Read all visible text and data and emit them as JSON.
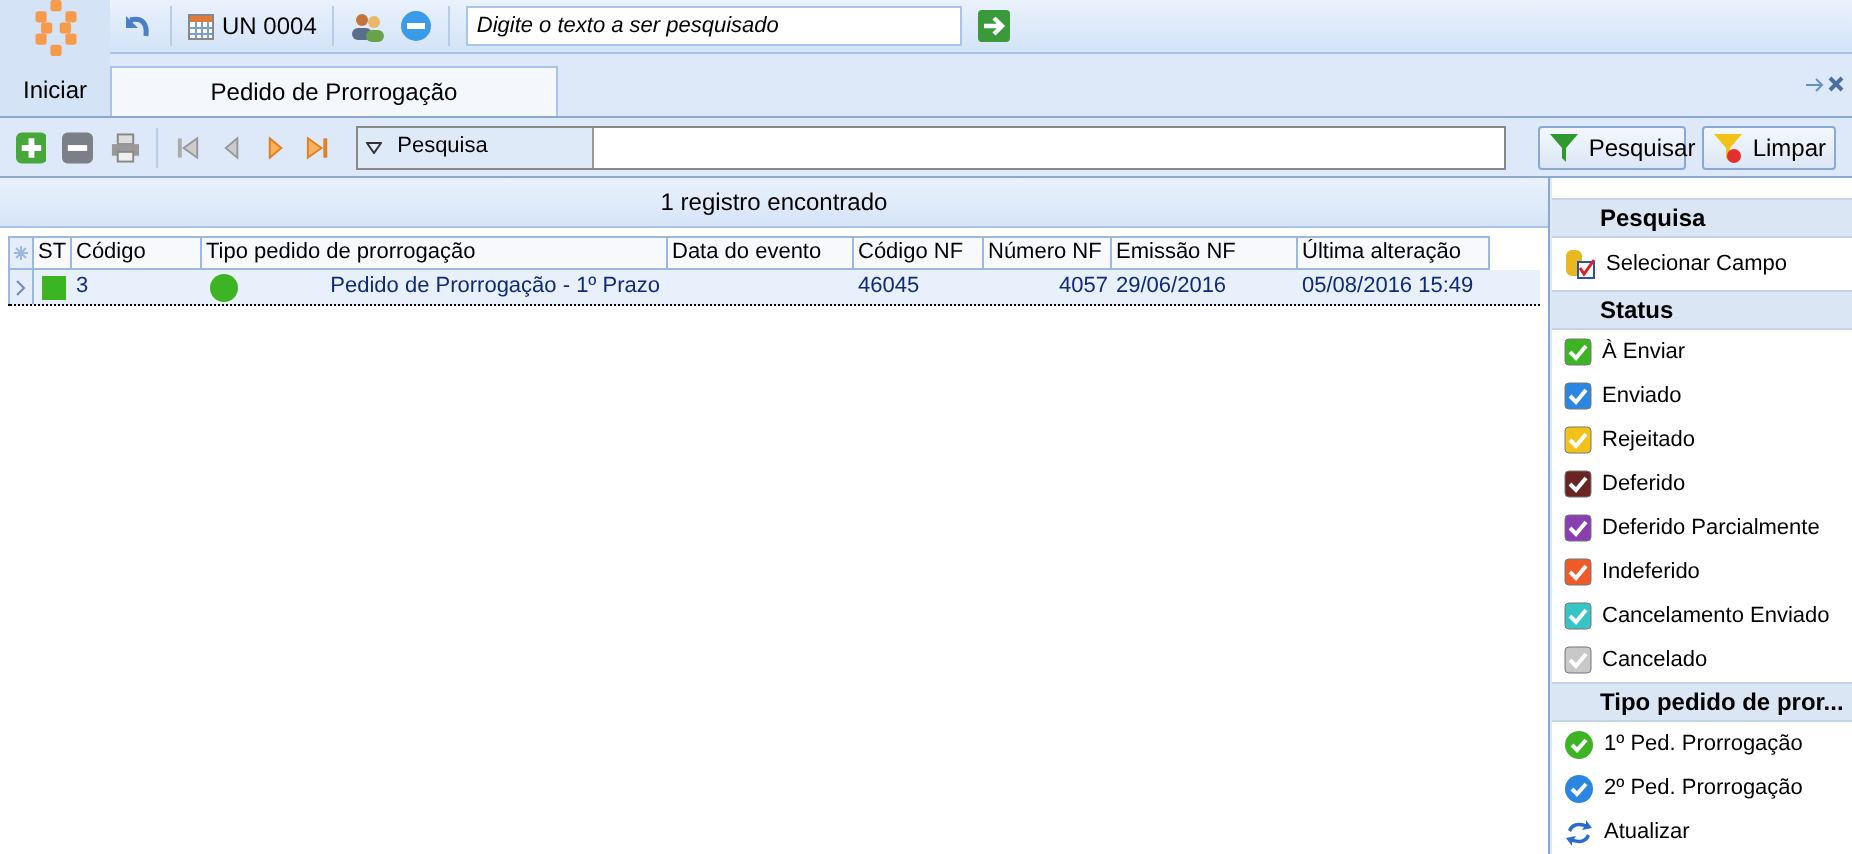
{
  "start_button": "Iniciar",
  "top_toolbar": {
    "unit": "UN 0004",
    "search": {
      "placeholder": "Digite o texto a ser pesquisado"
    }
  },
  "tab": {
    "label": "Pedido de Prorrogação"
  },
  "search_bar": {
    "dropdown": "Pesquisa",
    "buttons": [
      "Pesquisar",
      "Limpar"
    ]
  },
  "grid": {
    "summary": "1 registro encontrado",
    "columns": [
      "ST",
      "Código",
      "Tipo pedido de prorrogação",
      "Data do evento",
      "Código NF",
      "Número NF",
      "Emissão NF",
      "Última alteração"
    ],
    "rows": [
      {
        "selected": true,
        "status": {
          "color": "#3cb424"
        },
        "type_icon": {
          "color": "#3cb424"
        },
        "cells": [
          "",
          "3",
          "Pedido de Prorrogação - 1º Prazo",
          "",
          "46045",
          "4057",
          "29/06/2016",
          "05/08/2016 15:49"
        ]
      }
    ]
  },
  "side_panel": [
    {
      "title": "Pesquisa",
      "items": [
        {
          "kind": "field",
          "label": "Selecionar Campo"
        }
      ]
    },
    {
      "title": "Status",
      "items": [
        {
          "kind": "check",
          "label": "À Enviar",
          "color": "#3cb424"
        },
        {
          "kind": "check",
          "label": "Enviado",
          "color": "#2a86e0"
        },
        {
          "kind": "check",
          "label": "Rejeitado",
          "color": "#f2c21a"
        },
        {
          "kind": "check",
          "label": "Deferido",
          "color": "#6b2424"
        },
        {
          "kind": "check",
          "label": "Deferido Parcialmente",
          "color": "#8a3fb0"
        },
        {
          "kind": "check",
          "label": "Indeferido",
          "color": "#ee5a2a"
        },
        {
          "kind": "check",
          "label": "Cancelamento Enviado",
          "color": "#36c4c4"
        },
        {
          "kind": "check",
          "label": "Cancelado",
          "color": "#c8c8c8"
        }
      ]
    },
    {
      "title": "Tipo pedido de pror...",
      "items": [
        {
          "kind": "circle",
          "label": "1º Ped. Prorrogação",
          "color": "#3cb424"
        },
        {
          "kind": "circle",
          "label": "2º Ped. Prorrogação",
          "color": "#2a86e0"
        },
        {
          "kind": "refresh",
          "label": "Atualizar"
        }
      ]
    }
  ]
}
